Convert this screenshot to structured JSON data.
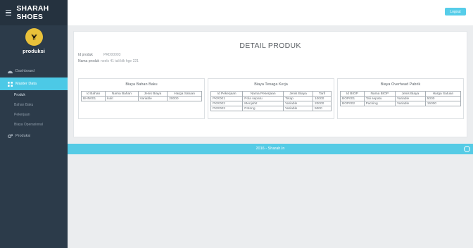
{
  "sidebar": {
    "app_title": "SHARAH SHOES",
    "profile_name": "produksi",
    "menu": {
      "dashboard": "Dashboard",
      "master_data": "Master Data",
      "produksi": "Produksi"
    },
    "submenu": {
      "produk": "Produk",
      "bahan_baku": "Bahan Baku",
      "pekerjaan": "Pekerjaan",
      "biaya_operasional": "Biaya Operasional"
    }
  },
  "topbar": {
    "logout_label": "Logout"
  },
  "detail": {
    "title": "DETAIL PRODUK",
    "id_label": "Id produk",
    "id_value": "PRD00003",
    "name_label": "Nama produk",
    "name_value": "noels 41 tali blk hge 221"
  },
  "bahan_baku": {
    "title": "Biaya Bahan Baku",
    "headers": [
      "Id Bahan",
      "Nama Bahan",
      "Jenis Biaya",
      "Harga Satuan"
    ],
    "rows": [
      [
        "BHN001",
        "kulit",
        "Variable",
        "20000"
      ]
    ]
  },
  "tenaga_kerja": {
    "title": "Biaya Tenaga Kerja",
    "headers": [
      "Id Pekerjaan",
      "Nama Pekerjaan",
      "Jenis Biaya",
      "Tarif"
    ],
    "rows": [
      [
        "PKR001",
        "Pola sepatu",
        "Tetap",
        "10000"
      ],
      [
        "PKR002",
        "Menjahit",
        "Variable",
        "20000"
      ],
      [
        "PKR003",
        "Potong",
        "Variable",
        "5000"
      ]
    ]
  },
  "overhead": {
    "title": "Biaya Overhead Pabrik",
    "headers": [
      "Id BIOP",
      "Nama BIOP",
      "Jenis Biaya",
      "Harga Satuan"
    ],
    "rows": [
      [
        "BOP001",
        "Tali sepatu",
        "Variable",
        "5000"
      ],
      [
        "BOP002",
        "Packing",
        "Variable",
        "15000"
      ]
    ]
  },
  "footer": {
    "text": "2016 - Sharah.In"
  },
  "colors": {
    "accent": "#4cc9e6",
    "sidebar": "#2c3b4a",
    "avatar": "#e9c13a"
  }
}
